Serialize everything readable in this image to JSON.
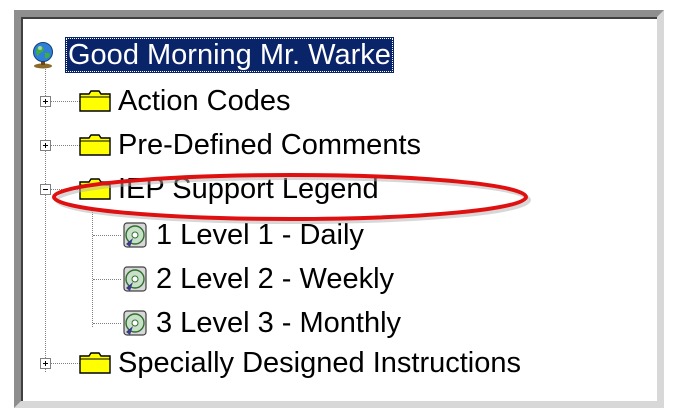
{
  "tree": {
    "root": {
      "label": "Good Morning Mr. Warke",
      "icon": "globe-icon",
      "selected": true
    },
    "nodes": [
      {
        "label": "Action Codes",
        "icon": "folder-icon",
        "expander": "plus"
      },
      {
        "label": "Pre-Defined Comments",
        "icon": "folder-icon",
        "expander": "plus"
      },
      {
        "label": "IEP Support Legend",
        "icon": "folder-icon",
        "expander": "minus",
        "expanded": true,
        "children": [
          {
            "label": "1 Level 1 - Daily",
            "icon": "disc-icon"
          },
          {
            "label": "2 Level 2 - Weekly",
            "icon": "disc-icon"
          },
          {
            "label": "3 Level 3 - Monthly",
            "icon": "disc-icon"
          }
        ]
      },
      {
        "label": "Specially Designed Instructions",
        "icon": "folder-icon",
        "expander": "plus"
      }
    ]
  },
  "colors": {
    "selection": "#0a246a",
    "folder": "#ffff00",
    "annotation": "#e01010"
  }
}
